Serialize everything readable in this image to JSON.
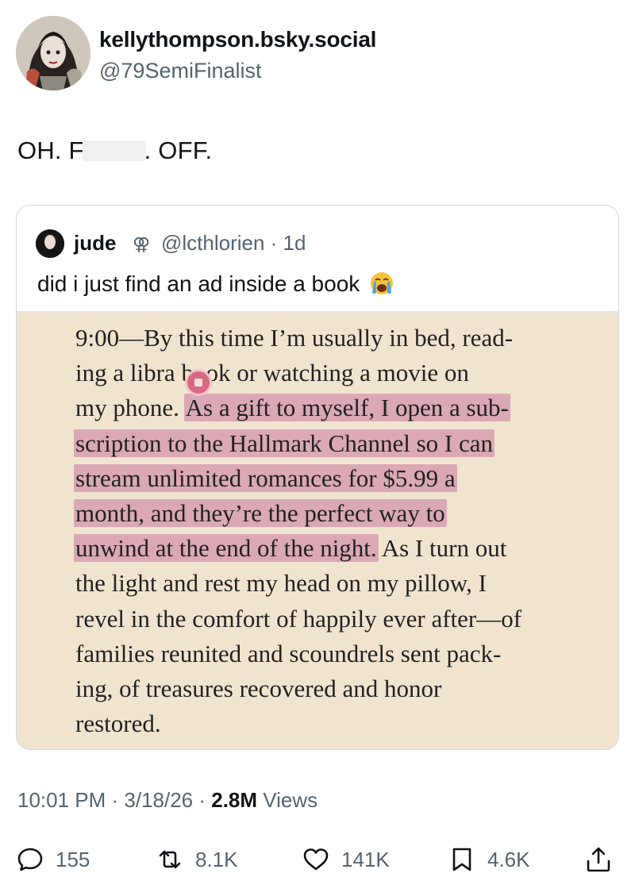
{
  "author": {
    "display_name": "kellythompson.bsky.social",
    "handle": "@79SemiFinalist",
    "avatar_icon": "avatar-illustration"
  },
  "tweet": {
    "text_before": "OH. F",
    "text_after": ". OFF."
  },
  "quoted": {
    "name": "jude",
    "symbol": "⚢",
    "handle_time": "@lcthlorien · 1d",
    "text": "did i just find an ad inside a book",
    "emoji_icon": "loudly-crying-face-icon",
    "book_page": {
      "lines": [
        {
          "pre": "9:00—By this time I’m usually in bed, read-",
          "hl": "",
          "post": ""
        },
        {
          "pre": "ing a libra",
          "hl": "",
          "post": " book or watching a movie on"
        },
        {
          "pre": "my phone. ",
          "hl": "As a gift to myself, I open a sub-",
          "post": ""
        },
        {
          "pre": "",
          "hl": "scription to the Hallmark Channel so I can",
          "post": ""
        },
        {
          "pre": "",
          "hl": "stream unlimited romances for $5.99 a",
          "post": ""
        },
        {
          "pre": "",
          "hl": "month, and they’re the perfect way to",
          "post": ""
        },
        {
          "pre": "",
          "hl": "unwind at the end of the night.",
          "post": " As I turn out"
        },
        {
          "pre": "the light and rest my head on my pillow, I",
          "hl": "",
          "post": ""
        },
        {
          "pre": "revel in the comfort of happily ever after—of",
          "hl": "",
          "post": ""
        },
        {
          "pre": "families reunited and scoundrels sent pack-",
          "hl": "",
          "post": ""
        },
        {
          "pre": "ing, of treasures recovered and honor",
          "hl": "",
          "post": ""
        },
        {
          "pre": "restored.",
          "hl": "",
          "post": ""
        }
      ],
      "highlight_color": "#dba8b5",
      "page_color": "#f1e4cf"
    }
  },
  "meta": {
    "time_date": "10:01 PM · 3/18/26 · ",
    "views_count": "2.8M",
    "views_label": " Views"
  },
  "actions": {
    "replies": "155",
    "reposts": "8.1K",
    "likes": "141K",
    "bookmarks": "4.6K"
  },
  "colors": {
    "text": "#0f1419",
    "secondary": "#536471",
    "border": "#cfd9de"
  }
}
